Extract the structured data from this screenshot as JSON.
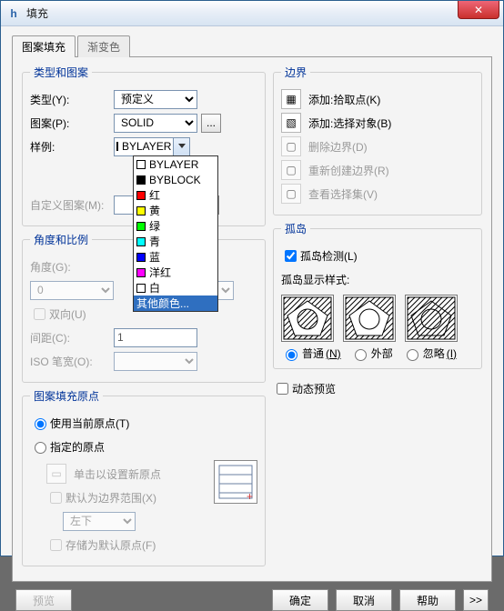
{
  "window": {
    "title": "填充",
    "close": "✕"
  },
  "tabs": {
    "hatch": "图案填充",
    "gradient": "渐变色"
  },
  "type_pattern": {
    "legend": "类型和图案",
    "type_label": "类型(Y):",
    "type_value": "预定义",
    "pattern_label": "图案(P):",
    "pattern_value": "SOLID",
    "swatch_label": "样例:",
    "swatch_value": "BYLAYER",
    "custom_label": "自定义图案(M):",
    "ellipsis": "..."
  },
  "dropdown": {
    "items": [
      {
        "label": "BYLAYER",
        "color": "#ffffff"
      },
      {
        "label": "BYBLOCK",
        "color": "#000000"
      },
      {
        "label": "红",
        "color": "#ff0000"
      },
      {
        "label": "黄",
        "color": "#ffff00"
      },
      {
        "label": "绿",
        "color": "#00ff00"
      },
      {
        "label": "青",
        "color": "#00ffff"
      },
      {
        "label": "蓝",
        "color": "#0000ff"
      },
      {
        "label": "洋红",
        "color": "#ff00ff"
      },
      {
        "label": "白",
        "color": "#ffffff"
      }
    ],
    "other": "其他颜色..."
  },
  "angle_scale": {
    "legend": "角度和比例",
    "angle_label": "角度(G):",
    "angle_value": "0",
    "double_label": "双向(U)",
    "spacing_label": "间距(C):",
    "spacing_value": "1",
    "iso_label": "ISO 笔宽(O):"
  },
  "origin": {
    "legend": "图案填充原点",
    "use_current": "使用当前原点(T)",
    "specified": "指定的原点",
    "click_set": "单击以设置新原点",
    "default_bounds": "默认为边界范围(X)",
    "corner_value": "左下",
    "store_default": "存储为默认原点(F)"
  },
  "boundary": {
    "legend": "边界",
    "add_pick": "添加:拾取点(K)",
    "add_select": "添加:选择对象(B)",
    "remove": "删除边界(D)",
    "recreate": "重新创建边界(R)",
    "view_sel": "查看选择集(V)"
  },
  "islands": {
    "legend": "孤岛",
    "detect": "孤岛检测(L)",
    "display_style": "孤岛显示样式:",
    "normal": "普通",
    "normal_key": "(N)",
    "outer": "外部",
    "ignore": "忽略",
    "ignore_key": "(I)"
  },
  "dynamic_preview": "动态预览",
  "buttons": {
    "preview": "预览",
    "ok": "确定",
    "cancel": "取消",
    "help": "帮助",
    "expand": ">>"
  }
}
